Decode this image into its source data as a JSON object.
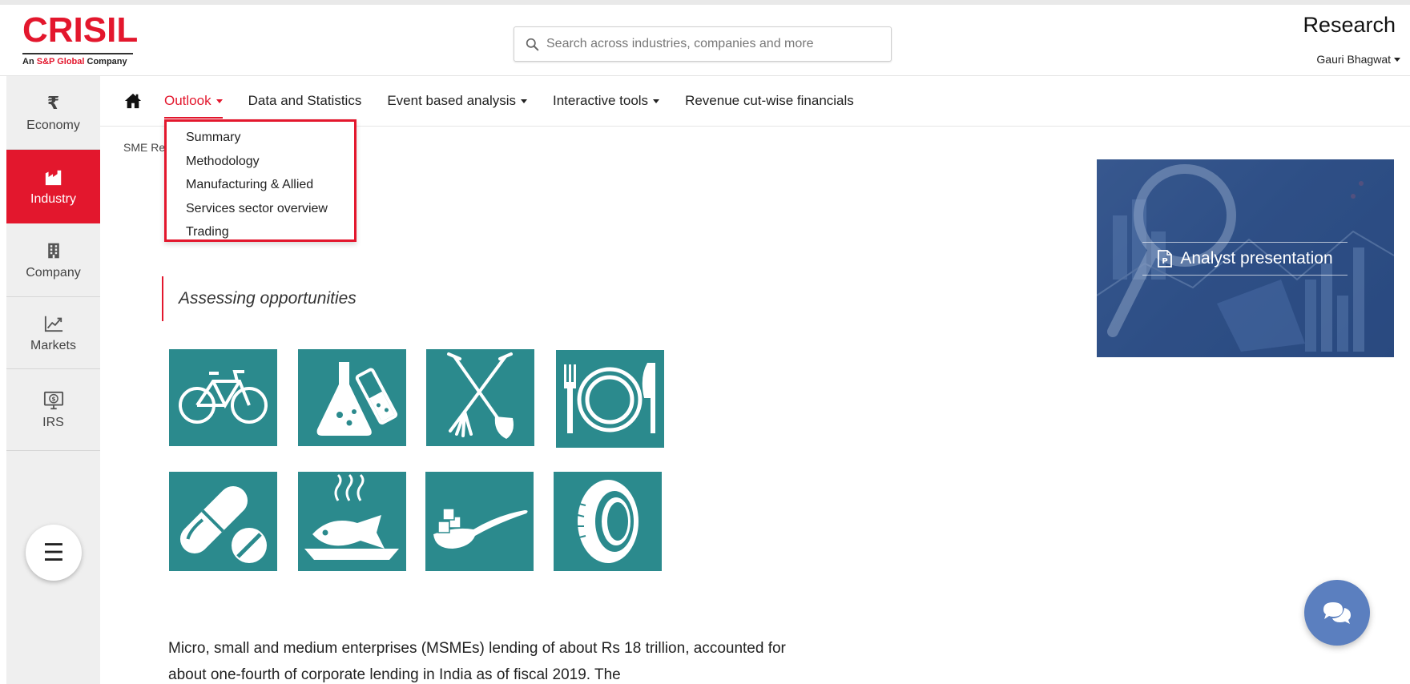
{
  "header": {
    "logo": {
      "word": "CRISIL",
      "sub_prefix": "An ",
      "sub_brand": "S&P Global",
      "sub_suffix": " Company"
    },
    "search_placeholder": "Search across industries, companies and more",
    "title": "Research",
    "user_name": "Gauri Bhagwat"
  },
  "sidebar": {
    "items": [
      {
        "label": "Economy",
        "icon": "rupee-icon"
      },
      {
        "label": "Industry",
        "icon": "factory-icon",
        "active": true
      },
      {
        "label": "Company",
        "icon": "building-icon"
      },
      {
        "label": "Markets",
        "icon": "chart-line-icon"
      },
      {
        "label": "IRS",
        "icon": "monitor-dollar-icon"
      }
    ],
    "menu_button_icon": "hamburger-icon"
  },
  "nav": {
    "items": [
      {
        "label": "Outlook",
        "has_caret": true,
        "active": true
      },
      {
        "label": "Data and Statistics",
        "has_caret": false
      },
      {
        "label": "Event based analysis",
        "has_caret": true
      },
      {
        "label": "Interactive tools",
        "has_caret": true
      },
      {
        "label": "Revenue cut-wise financials",
        "has_caret": false
      }
    ]
  },
  "breadcrumb": "SME Re",
  "dropdown": {
    "items": [
      "Summary",
      "Methodology",
      "Manufacturing & Allied",
      "Services sector overview",
      "Trading"
    ]
  },
  "quote": "Assessing opportunities",
  "tiles": [
    {
      "icon": "bicycle-icon"
    },
    {
      "icon": "chemistry-flask-icon"
    },
    {
      "icon": "tools-shovel-fork-icon"
    },
    {
      "icon": "plate-fork-knife-icon"
    },
    {
      "icon": "pills-icon"
    },
    {
      "icon": "fish-dish-icon"
    },
    {
      "icon": "sugar-spoon-icon"
    },
    {
      "icon": "tyre-icon"
    }
  ],
  "analyst_card": {
    "label": "Analyst presentation",
    "icon": "pdf-file-icon"
  },
  "body_text": "Micro, small and medium enterprises (MSMEs) lending of about Rs 18 trillion, accounted for about one-fourth of corporate lending in India as of fiscal 2019. The",
  "colors": {
    "brand_red": "#e3172d",
    "tile_teal": "#2b8a8d",
    "chat_blue": "#5b7fbf",
    "sidebar_gray": "#efefef"
  }
}
